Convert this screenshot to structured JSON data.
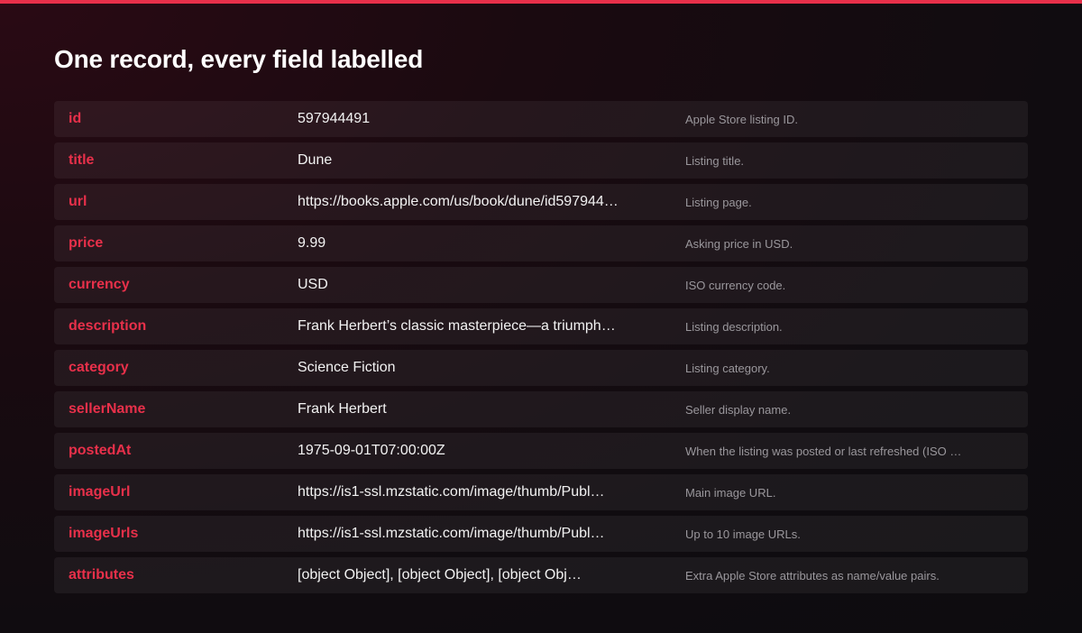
{
  "theme": {
    "accent": "#e8304a",
    "background": "#120c10"
  },
  "page": {
    "title": "One record, every field labelled"
  },
  "fields": [
    {
      "name": "id",
      "value": "597944491",
      "description": "Apple Store listing ID."
    },
    {
      "name": "title",
      "value": "Dune",
      "description": "Listing title."
    },
    {
      "name": "url",
      "value": "https://books.apple.com/us/book/dune/id597944…",
      "description": "Listing page."
    },
    {
      "name": "price",
      "value": "9.99",
      "description": "Asking price in USD."
    },
    {
      "name": "currency",
      "value": "USD",
      "description": "ISO currency code."
    },
    {
      "name": "description",
      "value": "Frank Herbert’s classic masterpiece—a triumph…",
      "description": "Listing description."
    },
    {
      "name": "category",
      "value": "Science Fiction",
      "description": "Listing category."
    },
    {
      "name": "sellerName",
      "value": "Frank Herbert",
      "description": "Seller display name."
    },
    {
      "name": "postedAt",
      "value": "1975-09-01T07:00:00Z",
      "description": "When the listing was posted or last refreshed (ISO …"
    },
    {
      "name": "imageUrl",
      "value": "https://is1-ssl.mzstatic.com/image/thumb/Publ…",
      "description": "Main image URL."
    },
    {
      "name": "imageUrls",
      "value": "https://is1-ssl.mzstatic.com/image/thumb/Publ…",
      "description": "Up to 10 image URLs."
    },
    {
      "name": "attributes",
      "value": "[object Object], [object Object], [object Obj…",
      "description": "Extra Apple Store attributes as name/value pairs."
    }
  ]
}
